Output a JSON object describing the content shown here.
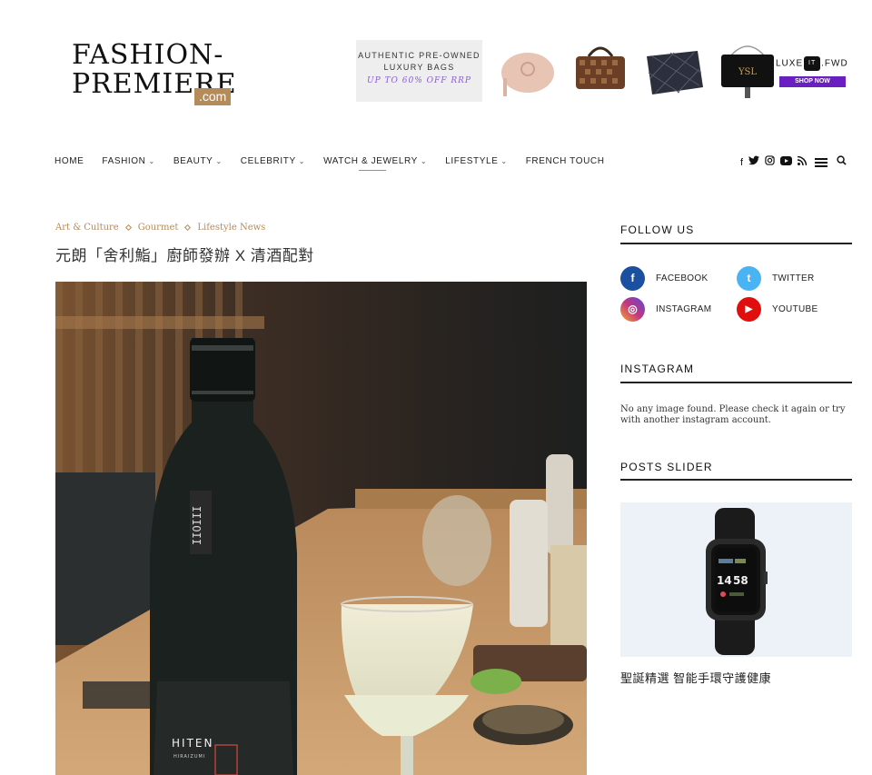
{
  "logo": {
    "line1": "FASHION-",
    "line2": "PREMIERE",
    "suffix": ".com"
  },
  "banner": {
    "line1": "AUTHENTIC PRE-OWNED",
    "line2": "LUXURY BAGS",
    "line3": "UP TO 60% OFF RRP",
    "brand_left": "LUXE",
    "brand_mid": "IT",
    "brand_right": "FWD",
    "cta": "SHOP NOW"
  },
  "nav": {
    "items": [
      {
        "label": "HOME",
        "dropdown": false
      },
      {
        "label": "FASHION",
        "dropdown": true
      },
      {
        "label": "BEAUTY",
        "dropdown": true
      },
      {
        "label": "CELEBRITY",
        "dropdown": true
      },
      {
        "label": "WATCH & JEWELRY",
        "dropdown": true
      },
      {
        "label": "LIFESTYLE",
        "dropdown": true
      },
      {
        "label": "FRENCH TOUCH",
        "dropdown": false
      }
    ],
    "active_index": 4,
    "icons": [
      "facebook-icon",
      "twitter-icon",
      "instagram-icon",
      "youtube-icon",
      "rss-icon",
      "menu-icon",
      "search-icon"
    ]
  },
  "article": {
    "categories": [
      "Art & Culture",
      "Gourmet",
      "Lifestyle News"
    ],
    "title": "元朗「舍利鮨」廚師發辦 X 清酒配對",
    "bottle_label": "HITEN",
    "bottle_sublabel": "HIRAIZUMI",
    "bottle_neck_text": "IIOIII"
  },
  "sidebar": {
    "follow_title": "FOLLOW US",
    "social": [
      {
        "name": "facebook",
        "label": "FACEBOOK",
        "glyph": "f",
        "color": "#1b4fa0"
      },
      {
        "name": "twitter",
        "label": "TWITTER",
        "glyph": "t",
        "color": "#4ab3f4"
      },
      {
        "name": "instagram",
        "label": "INSTAGRAM",
        "glyph": "◎",
        "color": "#c13584"
      },
      {
        "name": "youtube",
        "label": "YOUTUBE",
        "glyph": "▶",
        "color": "#e10e0e"
      }
    ],
    "instagram_title": "INSTAGRAM",
    "instagram_message": "No any image found. Please check it again or try with another instagram account.",
    "slider_title": "POSTS SLIDER",
    "slide_caption": "聖誕精選 智能手環守護健康",
    "watch_time_h": "14",
    "watch_time_m": "58"
  }
}
